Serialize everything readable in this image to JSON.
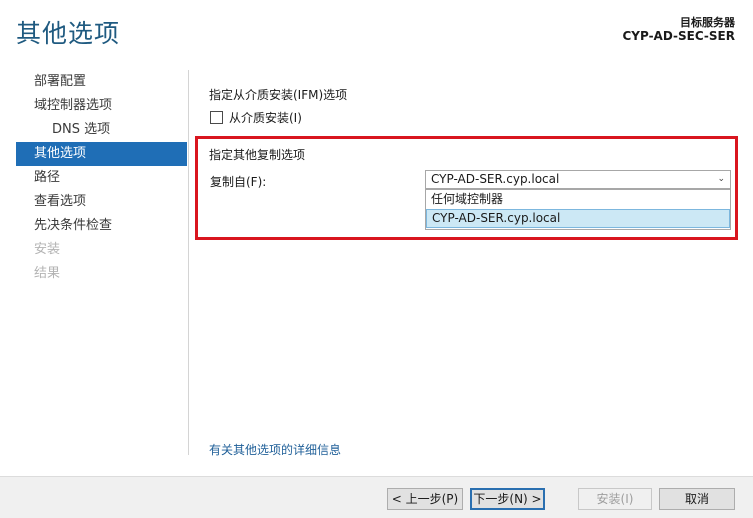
{
  "header": {
    "title": "其他选项",
    "target_label": "目标服务器",
    "target_server": "CYP-AD-SEC-SER"
  },
  "sidebar": {
    "items": [
      {
        "label": "部署配置"
      },
      {
        "label": "域控制器选项"
      },
      {
        "label": "DNS 选项"
      },
      {
        "label": "其他选项"
      },
      {
        "label": "路径"
      },
      {
        "label": "查看选项"
      },
      {
        "label": "先决条件检查"
      },
      {
        "label": "安装"
      },
      {
        "label": "结果"
      }
    ]
  },
  "main": {
    "ifm_heading": "指定从介质安装(IFM)选项",
    "ifm_checkbox_label": "从介质安装(I)",
    "replication_heading": "指定其他复制选项",
    "replicate_from_label": "复制自(F):",
    "replicate_from_value": "CYP-AD-SER.cyp.local",
    "dropdown_options": [
      "任何域控制器",
      "CYP-AD-SER.cyp.local"
    ],
    "more_info_link": "有关其他选项的详细信息"
  },
  "footer": {
    "prev_label": "< 上一步(P)",
    "next_label": "下一步(N) >",
    "install_label": "安装(I)",
    "cancel_label": "取消"
  },
  "colors": {
    "title": "#1f5a80",
    "nav_active": "#1f6eb6",
    "highlight_border": "#d9161f",
    "link": "#1f5f98"
  }
}
